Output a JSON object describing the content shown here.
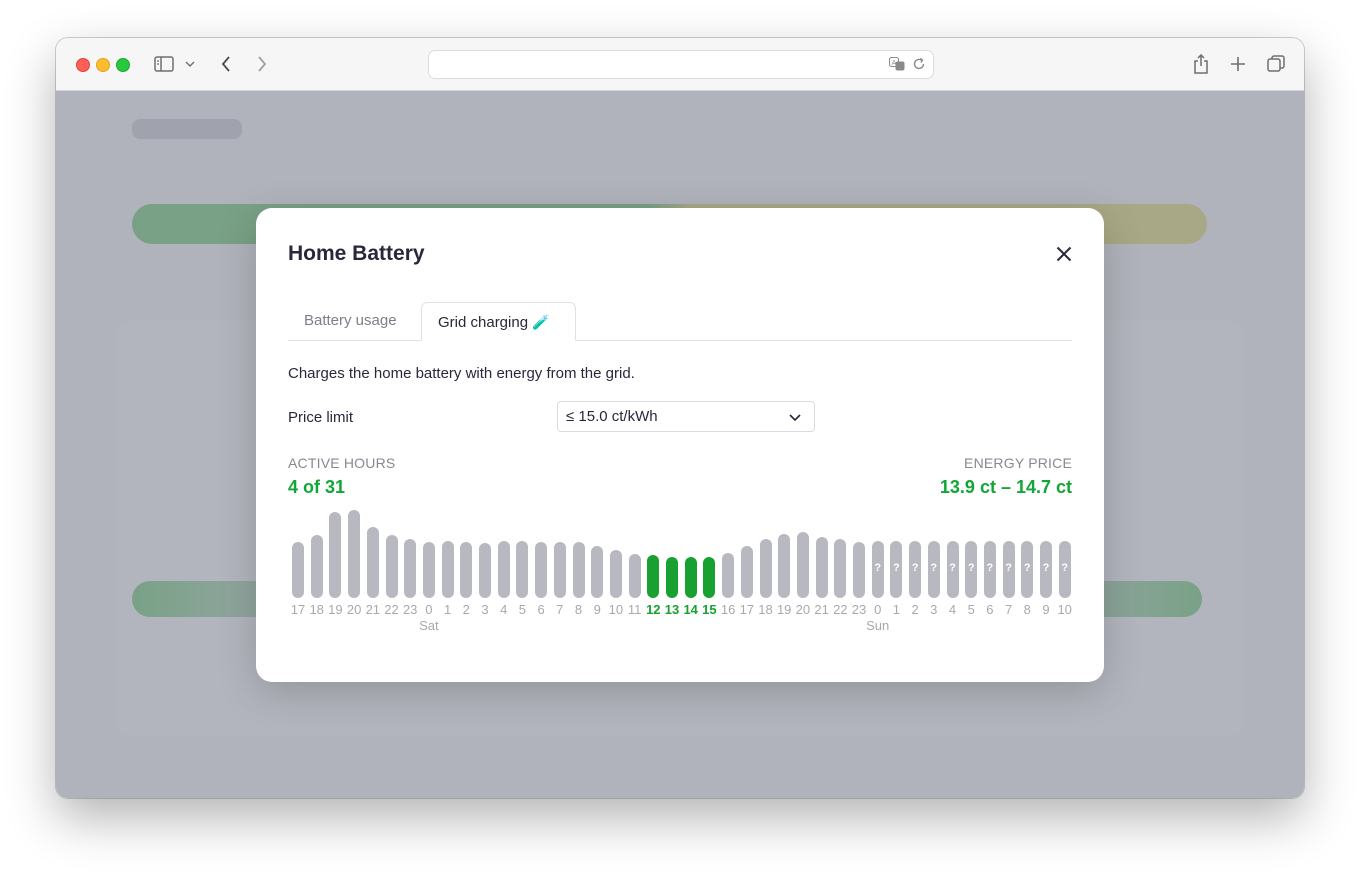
{
  "modal": {
    "title": "Home Battery",
    "tabs": [
      {
        "label": "Battery usage",
        "selected": false
      },
      {
        "label": "Grid charging",
        "emoji": "🧪",
        "selected": true
      }
    ],
    "description": "Charges the home battery with energy from the grid.",
    "price_limit": {
      "label": "Price limit",
      "value": "≤ 15.0 ct/kWh"
    },
    "active_hours": {
      "label": "ACTIVE HOURS",
      "value": "4 of 31"
    },
    "energy_price": {
      "label": "ENERGY PRICE",
      "value": "13.9 ct – 14.7 ct"
    }
  },
  "colors": {
    "active": "#18a131",
    "bar": "#b7b8c0",
    "value_green": "#12a636"
  },
  "icons": {
    "close": "close-icon",
    "chevron": "chevron-down-icon"
  },
  "chart_data": {
    "type": "bar",
    "categories": [
      "17",
      "18",
      "19",
      "20",
      "21",
      "22",
      "23",
      "0",
      "1",
      "2",
      "3",
      "4",
      "5",
      "6",
      "7",
      "8",
      "9",
      "10",
      "11",
      "12",
      "13",
      "14",
      "15",
      "16",
      "17",
      "18",
      "19",
      "20",
      "21",
      "22",
      "23",
      "0",
      "1",
      "2",
      "3",
      "4",
      "5",
      "6",
      "7",
      "8",
      "9",
      "10"
    ],
    "values": [
      56,
      63,
      86,
      88,
      71,
      63,
      59,
      56,
      57,
      56,
      55,
      57,
      57,
      56,
      56,
      56,
      52,
      48,
      44,
      43,
      41,
      41,
      41,
      45,
      52,
      59,
      64,
      66,
      61,
      59,
      56,
      57,
      57,
      57,
      57,
      57,
      57,
      57,
      57,
      57,
      57,
      57
    ],
    "active": [
      19,
      20,
      21,
      22
    ],
    "unknown": [
      31,
      32,
      33,
      34,
      35,
      36,
      37,
      38,
      39,
      40,
      41
    ],
    "unknown_mark": "?",
    "day_labels": [
      {
        "index": 7,
        "label": "Sat"
      },
      {
        "index": 31,
        "label": "Sun"
      }
    ]
  }
}
